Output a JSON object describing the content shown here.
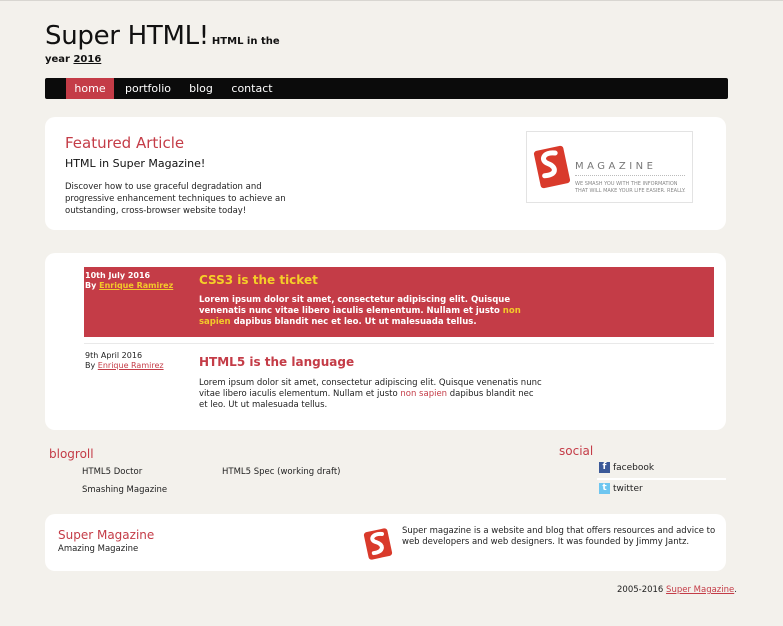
{
  "header": {
    "title": "Super HTML!",
    "title_small": "HTML in the",
    "tag_prefix": "year",
    "tag_year": "2016"
  },
  "nav": {
    "items": [
      {
        "label": "home",
        "active": true
      },
      {
        "label": "portfolio",
        "active": false
      },
      {
        "label": "blog",
        "active": false
      },
      {
        "label": "contact",
        "active": false
      }
    ]
  },
  "featured": {
    "heading": "Featured Article",
    "subheading": "HTML in Super Magazine!",
    "text": "Discover how to use graceful degradation and progressive enhancement techniques to achieve an outstanding, cross-browser website today!",
    "logo": {
      "wordmark": "MAGAZINE",
      "tagline": "WE SMASH YOU WITH THE INFORMATION THAT WILL MAKE YOUR LIFE EASIER. REALLY."
    }
  },
  "articles": [
    {
      "date": "10th July 2016",
      "by_prefix": "By",
      "author": "Enrique Ramirez",
      "title": "CSS3 is the ticket",
      "body_before": "Lorem ipsum dolor sit amet, consectetur adipiscing elit. Quisque venenatis nunc vitae libero iaculis elementum. Nullam et justo",
      "body_link": "non sapien",
      "body_after": "dapibus blandit nec et leo. Ut ut malesuada tellus."
    },
    {
      "date": "9th April 2016",
      "by_prefix": "By",
      "author": "Enrique Ramirez",
      "title": "HTML5 is the language",
      "body_before": "Lorem ipsum dolor sit amet, consectetur adipiscing elit. Quisque venenatis nunc vitae libero iaculis elementum. Nullam et justo",
      "body_link": "non sapien",
      "body_after": "dapibus blandit nec et leo. Ut ut malesuada tellus."
    }
  ],
  "blogroll": {
    "heading": "blogroll",
    "links": [
      "HTML5 Doctor",
      "HTML5 Spec (working draft)",
      "Smashing Magazine"
    ]
  },
  "social": {
    "heading": "social",
    "items": [
      {
        "label": "facebook",
        "icon": "facebook-icon"
      },
      {
        "label": "twitter",
        "icon": "twitter-icon"
      }
    ]
  },
  "footer": {
    "title": "Super Magazine",
    "subtitle": "Amazing Magazine",
    "text": "Super magazine is a website and blog that offers resources and advice to web developers and web designers. It was founded by Jimmy Jantz.",
    "copyright_prefix": "2005-2016",
    "copyright_link": "Super Magazine",
    "copyright_suffix": "."
  },
  "colors": {
    "accent": "#c43c47",
    "highlight": "#f5cf28",
    "nav_bg": "#0b0b0b",
    "page_bg": "#f3f1ec"
  }
}
